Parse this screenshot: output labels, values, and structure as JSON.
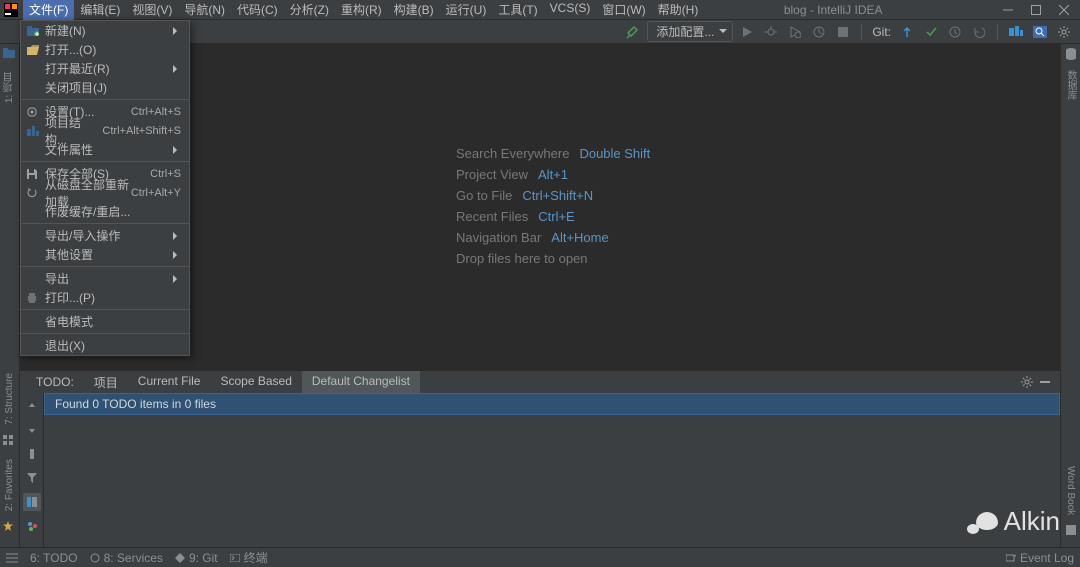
{
  "window": {
    "title": "blog - IntelliJ IDEA"
  },
  "menubar": {
    "items": [
      "文件(F)",
      "编辑(E)",
      "视图(V)",
      "导航(N)",
      "代码(C)",
      "分析(Z)",
      "重构(R)",
      "构建(B)",
      "运行(U)",
      "工具(T)",
      "VCS(S)",
      "窗口(W)",
      "帮助(H)"
    ]
  },
  "toolbar": {
    "run_config": "添加配置...",
    "git_label": "Git:"
  },
  "file_menu": [
    {
      "icon": "new",
      "label": "新建(N)",
      "shortcut": "",
      "submenu": true
    },
    {
      "icon": "open",
      "label": "打开...(O)",
      "shortcut": "",
      "submenu": false
    },
    {
      "icon": "",
      "label": "打开最近(R)",
      "shortcut": "",
      "submenu": true
    },
    {
      "icon": "",
      "label": "关闭项目(J)",
      "shortcut": "",
      "submenu": false
    },
    {
      "divider": true
    },
    {
      "icon": "settings",
      "label": "设置(T)...",
      "shortcut": "Ctrl+Alt+S",
      "submenu": false
    },
    {
      "icon": "structure",
      "label": "项目结构...",
      "shortcut": "Ctrl+Alt+Shift+S",
      "submenu": false
    },
    {
      "icon": "",
      "label": "文件属性",
      "shortcut": "",
      "submenu": true
    },
    {
      "divider": true
    },
    {
      "icon": "save",
      "label": "保存全部(S)",
      "shortcut": "Ctrl+S",
      "submenu": false
    },
    {
      "icon": "reload",
      "label": "从磁盘全部重新加载",
      "shortcut": "Ctrl+Alt+Y",
      "submenu": false
    },
    {
      "icon": "",
      "label": "作废缓存/重启...",
      "shortcut": "",
      "submenu": false
    },
    {
      "divider": true
    },
    {
      "icon": "",
      "label": "导出/导入操作",
      "shortcut": "",
      "submenu": true
    },
    {
      "icon": "",
      "label": "其他设置",
      "shortcut": "",
      "submenu": true
    },
    {
      "divider": true
    },
    {
      "icon": "",
      "label": "导出",
      "shortcut": "",
      "submenu": true
    },
    {
      "icon": "print",
      "label": "打印...(P)",
      "shortcut": "",
      "submenu": false
    },
    {
      "divider": true
    },
    {
      "icon": "",
      "label": "省电模式",
      "shortcut": "",
      "submenu": false
    },
    {
      "divider": true
    },
    {
      "icon": "",
      "label": "退出(X)",
      "shortcut": "",
      "submenu": false
    }
  ],
  "hints": [
    {
      "label": "Search Everywhere",
      "shortcut": "Double Shift"
    },
    {
      "label": "Project View",
      "shortcut": "Alt+1"
    },
    {
      "label": "Go to File",
      "shortcut": "Ctrl+Shift+N"
    },
    {
      "label": "Recent Files",
      "shortcut": "Ctrl+E"
    },
    {
      "label": "Navigation Bar",
      "shortcut": "Alt+Home"
    },
    {
      "label": "Drop files here to open",
      "shortcut": ""
    }
  ],
  "todo": {
    "title": "TODO:",
    "tabs": [
      "项目",
      "Current File",
      "Scope Based",
      "Default Changelist"
    ],
    "selected_tab": 3,
    "found": "Found 0 TODO items in 0 files"
  },
  "left_stripe": {
    "project_label": "1: 项目",
    "structure_label": "7: Structure",
    "favorites_label": "2: Favorites"
  },
  "right_stripe": {
    "db_label": "数据库",
    "wordbook_label": "Word Book"
  },
  "statusbar": {
    "todo": "6: TODO",
    "services": "8: Services",
    "git": "9: Git",
    "terminal": "终端",
    "eventlog": "Event Log"
  },
  "watermark": {
    "text": "Alkin"
  }
}
